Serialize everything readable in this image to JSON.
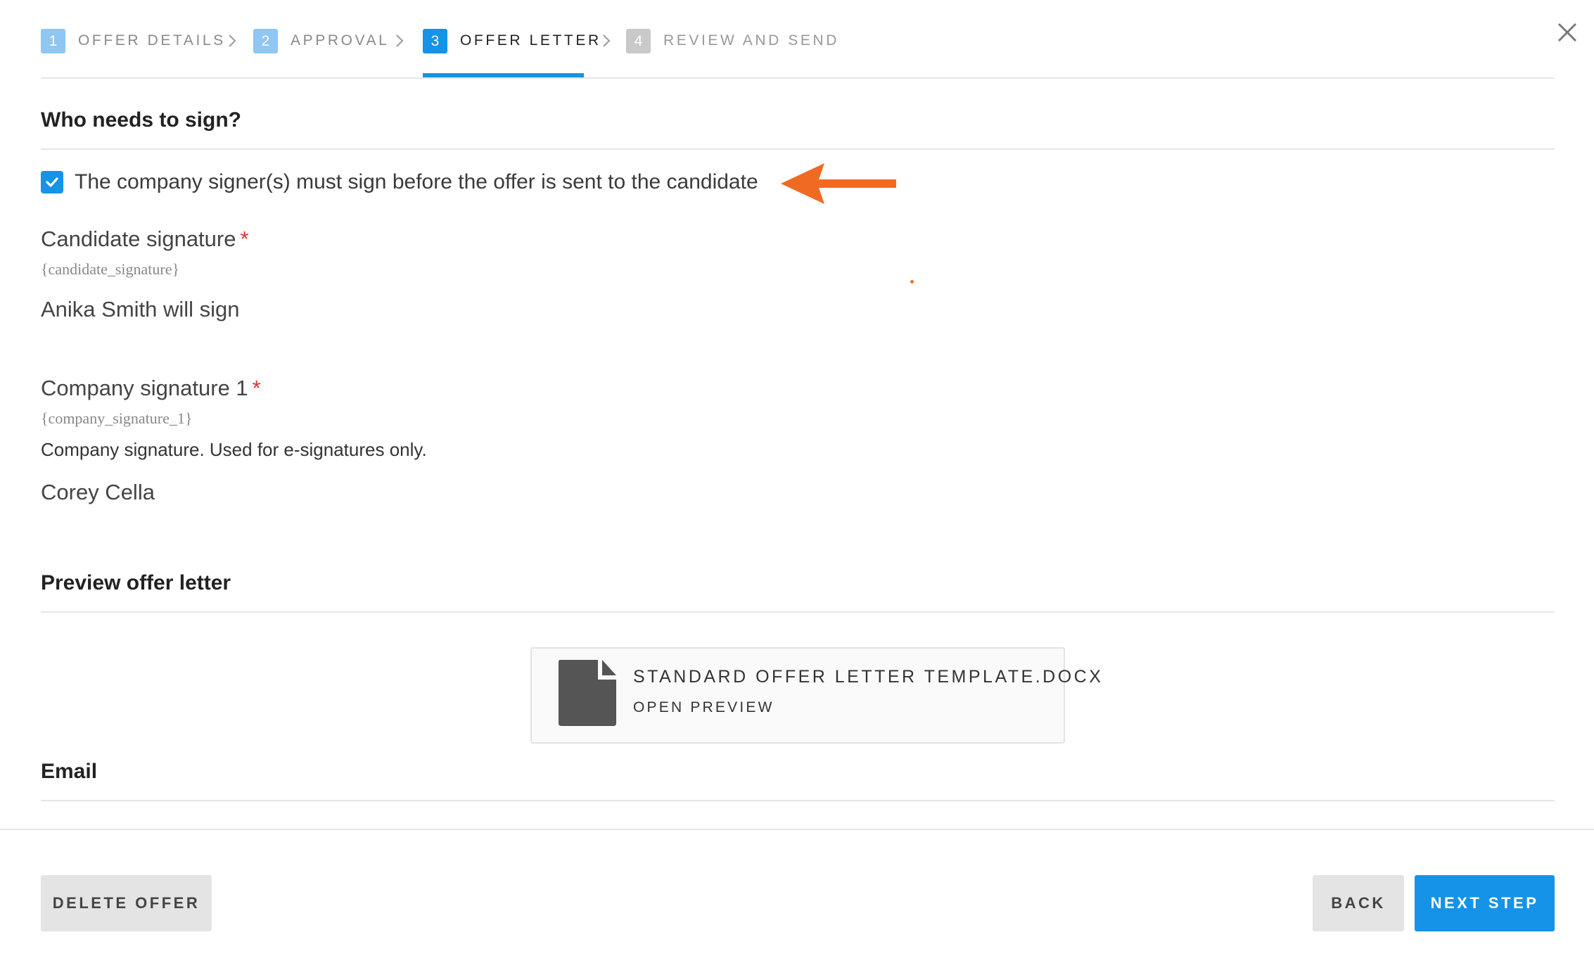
{
  "stepper": {
    "steps": [
      {
        "number": "1",
        "label": "OFFER DETAILS",
        "state": "done"
      },
      {
        "number": "2",
        "label": "APPROVAL",
        "state": "done"
      },
      {
        "number": "3",
        "label": "OFFER LETTER",
        "state": "active"
      },
      {
        "number": "4",
        "label": "REVIEW AND SEND",
        "state": "todo"
      }
    ]
  },
  "signers": {
    "section_title": "Who needs to sign?",
    "company_first_label": "The company signer(s) must sign before the offer is sent to the candidate",
    "company_first_checked": true,
    "candidate": {
      "label": "Candidate signature",
      "required_mark": "*",
      "token": "{candidate_signature}",
      "value": "Anika Smith will sign"
    },
    "company": {
      "label": "Company signature 1",
      "required_mark": "*",
      "token": "{company_signature_1}",
      "description": "Company signature. Used for e-signatures only.",
      "value": "Corey Cella"
    }
  },
  "preview": {
    "section_title": "Preview offer letter",
    "file_name": "STANDARD OFFER LETTER TEMPLATE.DOCX",
    "action_label": "OPEN PREVIEW"
  },
  "email": {
    "section_title": "Email"
  },
  "footer": {
    "delete_label": "DELETE OFFER",
    "back_label": "BACK",
    "next_label": "NEXT STEP"
  },
  "colors": {
    "accent": "#1493e8",
    "annotation_arrow": "#f06a22",
    "required": "#dd3333"
  },
  "icons": {
    "close": "close-icon",
    "chevron": "chevron-right-icon",
    "check": "checkmark-icon",
    "file": "document-icon",
    "annotation": "arrow-left-icon"
  }
}
